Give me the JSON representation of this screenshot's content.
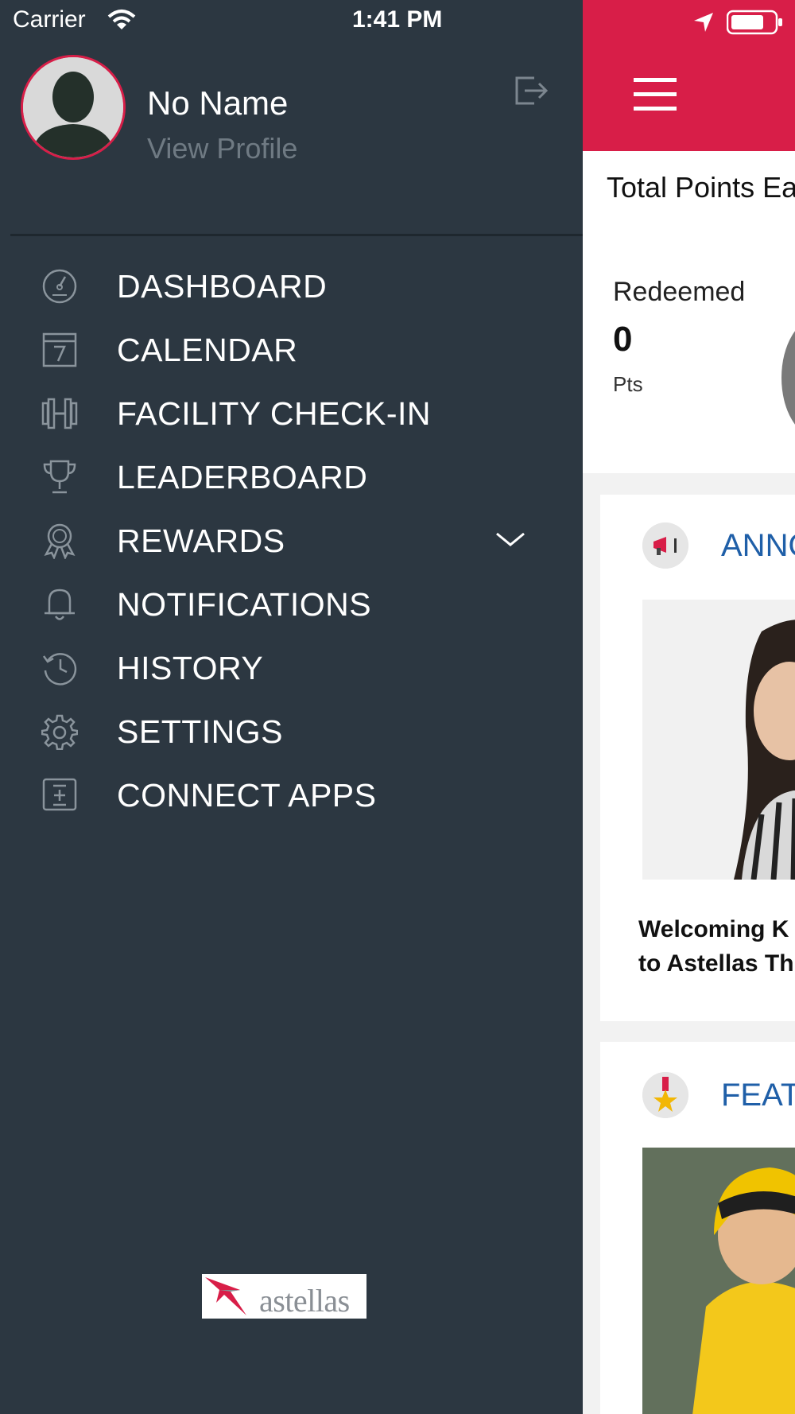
{
  "status_bar": {
    "carrier": "Carrier",
    "time": "1:41 PM"
  },
  "drawer": {
    "user_name": "No Name",
    "view_profile": "View Profile",
    "menu": [
      {
        "label": "DASHBOARD",
        "icon": "dashboard-icon"
      },
      {
        "label": "CALENDAR",
        "icon": "calendar-icon"
      },
      {
        "label": "FACILITY CHECK-IN",
        "icon": "dumbbell-icon"
      },
      {
        "label": "LEADERBOARD",
        "icon": "trophy-icon"
      },
      {
        "label": "REWARDS",
        "icon": "award-ribbon-icon"
      },
      {
        "label": "NOTIFICATIONS",
        "icon": "bell-icon"
      },
      {
        "label": "HISTORY",
        "icon": "history-icon"
      },
      {
        "label": "SETTINGS",
        "icon": "gear-icon"
      },
      {
        "label": "CONNECT APPS",
        "icon": "connect-apps-icon"
      }
    ],
    "logo_text": "astellas"
  },
  "main": {
    "total_points_label": "Total Points Ea",
    "redeemed_label": "Redeemed",
    "redeemed_value": "0",
    "redeemed_unit": "Pts",
    "announcement_title": "ANNOU",
    "announcement_caption_line1": "Welcoming K",
    "announcement_caption_line2": "to Astellas Th",
    "featured_title": "FEATU"
  },
  "colors": {
    "drawer_bg": "#2c3741",
    "accent": "#d81e48",
    "link_blue": "#1f5fa8"
  }
}
